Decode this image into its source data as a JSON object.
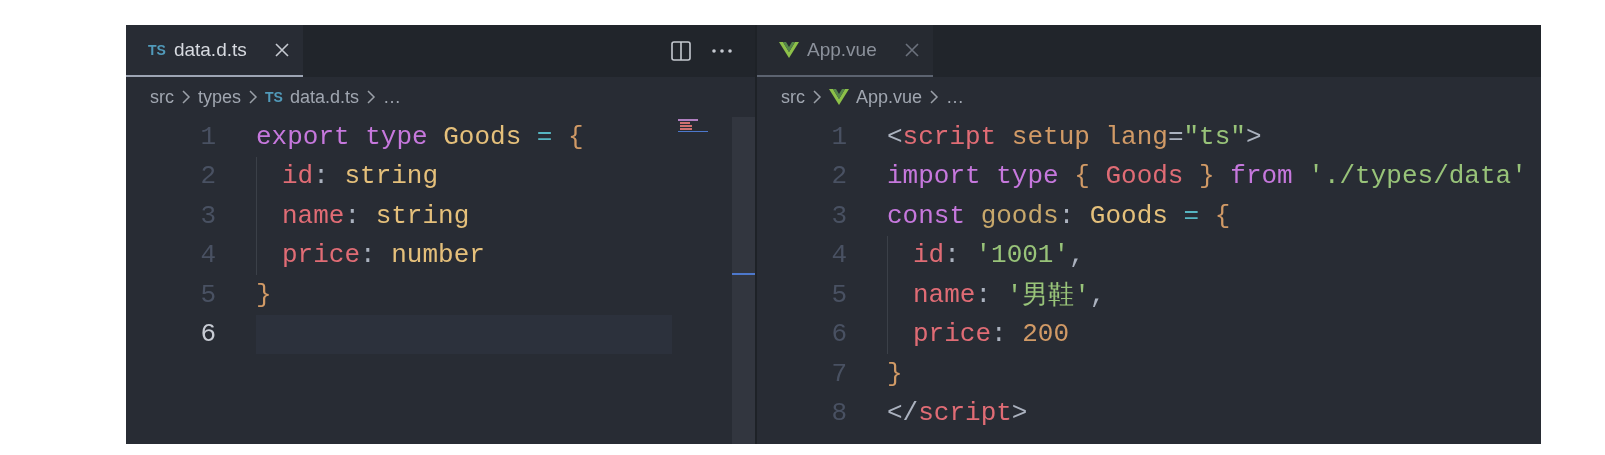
{
  "panes": [
    {
      "tabs": [
        {
          "kind": "ts-file",
          "icon_text": "TS",
          "label": "data.d.ts",
          "selected": true
        }
      ],
      "breadcrumbs": [
        {
          "kind": "folder",
          "label": "src"
        },
        {
          "kind": "folder",
          "label": "types"
        },
        {
          "kind": "ts-file",
          "icon_text": "TS",
          "label": "data.d.ts"
        },
        {
          "kind": "more",
          "label": "…"
        }
      ],
      "minimap": true,
      "lines": [
        {
          "number": "1",
          "current": false,
          "indent": false,
          "tokens": [
            {
              "text": "export ",
              "kind": "keyword"
            },
            {
              "text": "type ",
              "kind": "keyword"
            },
            {
              "text": "Goods ",
              "kind": "type"
            },
            {
              "text": "= ",
              "kind": "operator"
            },
            {
              "text": "{",
              "kind": "brace"
            }
          ]
        },
        {
          "number": "2",
          "current": false,
          "indent": true,
          "tokens": [
            {
              "text": "id",
              "kind": "property"
            },
            {
              "text": ": ",
              "kind": "punct"
            },
            {
              "text": "string",
              "kind": "type"
            }
          ]
        },
        {
          "number": "3",
          "current": false,
          "indent": true,
          "tokens": [
            {
              "text": "name",
              "kind": "property"
            },
            {
              "text": ": ",
              "kind": "punct"
            },
            {
              "text": "string",
              "kind": "type"
            }
          ]
        },
        {
          "number": "4",
          "current": false,
          "indent": true,
          "tokens": [
            {
              "text": "price",
              "kind": "property"
            },
            {
              "text": ": ",
              "kind": "punct"
            },
            {
              "text": "number",
              "kind": "type"
            }
          ]
        },
        {
          "number": "5",
          "current": false,
          "indent": false,
          "tokens": [
            {
              "text": "}",
              "kind": "brace"
            }
          ]
        },
        {
          "number": "6",
          "current": true,
          "indent": false
        }
      ]
    },
    {
      "tabs": [
        {
          "kind": "vue-file",
          "label": "App.vue",
          "selected": false
        }
      ],
      "breadcrumbs": [
        {
          "kind": "folder",
          "label": "src"
        },
        {
          "kind": "vue-file",
          "label": "App.vue"
        },
        {
          "kind": "more",
          "label": "…"
        }
      ],
      "minimap": false,
      "lines": [
        {
          "number": "1",
          "current": false,
          "indent": false,
          "tokens": [
            {
              "text": "<",
              "kind": "punct"
            },
            {
              "text": "script ",
              "kind": "tag"
            },
            {
              "text": "setup ",
              "kind": "attr"
            },
            {
              "text": "lang",
              "kind": "attr"
            },
            {
              "text": "=",
              "kind": "punct"
            },
            {
              "text": "\"ts\"",
              "kind": "string"
            },
            {
              "text": ">",
              "kind": "punct"
            }
          ]
        },
        {
          "number": "2",
          "current": false,
          "indent": false,
          "tokens": [
            {
              "text": "import ",
              "kind": "keyword"
            },
            {
              "text": "type ",
              "kind": "keyword"
            },
            {
              "text": "{ ",
              "kind": "brace"
            },
            {
              "text": "Goods ",
              "kind": "property"
            },
            {
              "text": "} ",
              "kind": "brace"
            },
            {
              "text": "from ",
              "kind": "keyword"
            },
            {
              "text": "'./types/data'",
              "kind": "string"
            }
          ]
        },
        {
          "number": "3",
          "current": false,
          "indent": false,
          "tokens": [
            {
              "text": "const ",
              "kind": "keyword"
            },
            {
              "text": "goods",
              "kind": "variable"
            },
            {
              "text": ": ",
              "kind": "punct"
            },
            {
              "text": "Goods ",
              "kind": "type"
            },
            {
              "text": "= ",
              "kind": "operator"
            },
            {
              "text": "{",
              "kind": "brace"
            }
          ]
        },
        {
          "number": "4",
          "current": false,
          "indent": true,
          "tokens": [
            {
              "text": "id",
              "kind": "property"
            },
            {
              "text": ": ",
              "kind": "punct"
            },
            {
              "text": "'1001'",
              "kind": "string"
            },
            {
              "text": ",",
              "kind": "punct"
            }
          ]
        },
        {
          "number": "5",
          "current": false,
          "indent": true,
          "tokens": [
            {
              "text": "name",
              "kind": "property"
            },
            {
              "text": ": ",
              "kind": "punct"
            },
            {
              "text": "'男鞋'",
              "kind": "string"
            },
            {
              "text": ",",
              "kind": "punct"
            }
          ]
        },
        {
          "number": "6",
          "current": false,
          "indent": true,
          "tokens": [
            {
              "text": "price",
              "kind": "property"
            },
            {
              "text": ": ",
              "kind": "punct"
            },
            {
              "text": "200",
              "kind": "number"
            }
          ]
        },
        {
          "number": "7",
          "current": false,
          "indent": false,
          "tokens": [
            {
              "text": "}",
              "kind": "brace"
            }
          ]
        },
        {
          "number": "8",
          "current": false,
          "indent": false,
          "tokens": [
            {
              "text": "</",
              "kind": "punct"
            },
            {
              "text": "script",
              "kind": "tag"
            },
            {
              "text": ">",
              "kind": "punct"
            }
          ]
        }
      ]
    }
  ]
}
